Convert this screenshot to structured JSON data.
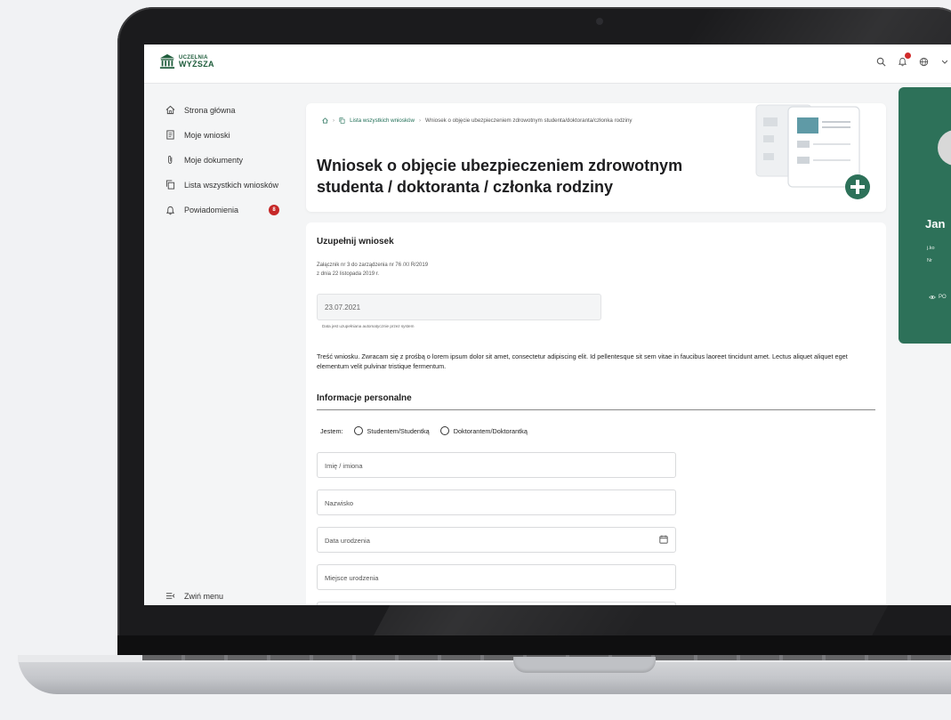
{
  "logo": {
    "line1": "UCZELNIA",
    "line2": "WYŻSZA"
  },
  "topbar": {
    "icons": [
      "search-icon",
      "bell-icon",
      "globe-icon"
    ]
  },
  "sidebar": {
    "items": [
      {
        "label": "Strona główna",
        "icon": "home-icon"
      },
      {
        "label": "Moje wnioski",
        "icon": "document-icon"
      },
      {
        "label": "Moje dokumenty",
        "icon": "paperclip-icon"
      },
      {
        "label": "Lista wszystkich wniosków",
        "icon": "copy-icon"
      },
      {
        "label": "Powiadomienia",
        "icon": "bell-icon",
        "badge": "8"
      }
    ],
    "collapse_label": "Zwiń menu"
  },
  "breadcrumb": {
    "link": "Lista wszystkich wniosków",
    "current": "Wniosek o objęcie ubezpieczeniem zdrowotnym studenta/doktoranta/członka rodziny"
  },
  "page_title": "Wniosek o objęcie ubezpieczeniem zdrowotnym studenta / doktoranta / członka rodziny",
  "form": {
    "heading": "Uzupełnij wniosek",
    "note_line1": "Załącznik nr 3 do zarządzenia nr 76 /XI R/2019",
    "note_line2": "z dnia 22 listopada 2019 r.",
    "date_value": "23.07.2021",
    "date_help": "Data jest uzupełniana automatycznie przez system",
    "body": "Treść wniosku. Zwracam się z prośbą o lorem ipsum dolor sit amet, consectetur adipiscing elit. Id pellentesque sit sem vitae in faucibus laoreet tincidunt amet. Lectus aliquet aliquet eget elementum velit pulvinar tristique fermentum.",
    "section_personal": "Informacje personalne",
    "radio_label": "Jestem:",
    "radio_options": [
      "Studentem/Studentką",
      "Doktorantem/Doktorantką"
    ],
    "fields": [
      {
        "placeholder": "Imię / imiona"
      },
      {
        "placeholder": "Nazwisko"
      },
      {
        "placeholder": "Data urodzenia"
      },
      {
        "placeholder": "Miejsce urodzenia"
      }
    ]
  },
  "profile": {
    "name": "Jan",
    "line1": "j.ko",
    "line2": "Nr",
    "link": "PO"
  },
  "colors": {
    "brand": "#2d7159",
    "badge": "#c62828",
    "link": "#1f6e56"
  }
}
